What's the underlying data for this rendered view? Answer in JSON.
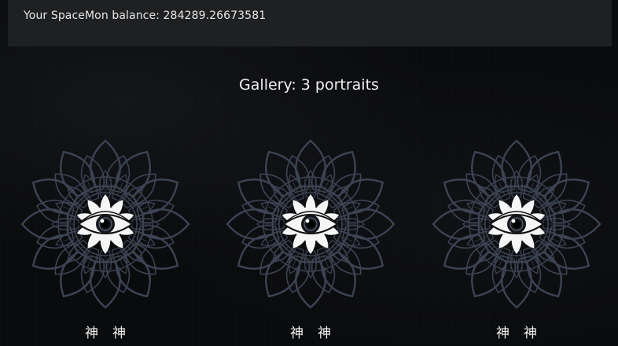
{
  "header": {
    "balance_label": "Your SpaceMon balance: 284289.26673581"
  },
  "gallery": {
    "title": "Gallery: 3 portraits",
    "portraits": [
      {
        "image": "all-seeing-eye-mandala",
        "glyphs": [
          "神",
          "神"
        ]
      },
      {
        "image": "all-seeing-eye-mandala",
        "glyphs": [
          "神",
          "神"
        ]
      },
      {
        "image": "all-seeing-eye-mandala",
        "glyphs": [
          "神",
          "神"
        ]
      }
    ]
  },
  "colors": {
    "background": "#0a0b0d",
    "header_bar": "#1f2022",
    "mandala_line": "#3c4353",
    "eye_fill": "#f5f5f5"
  }
}
